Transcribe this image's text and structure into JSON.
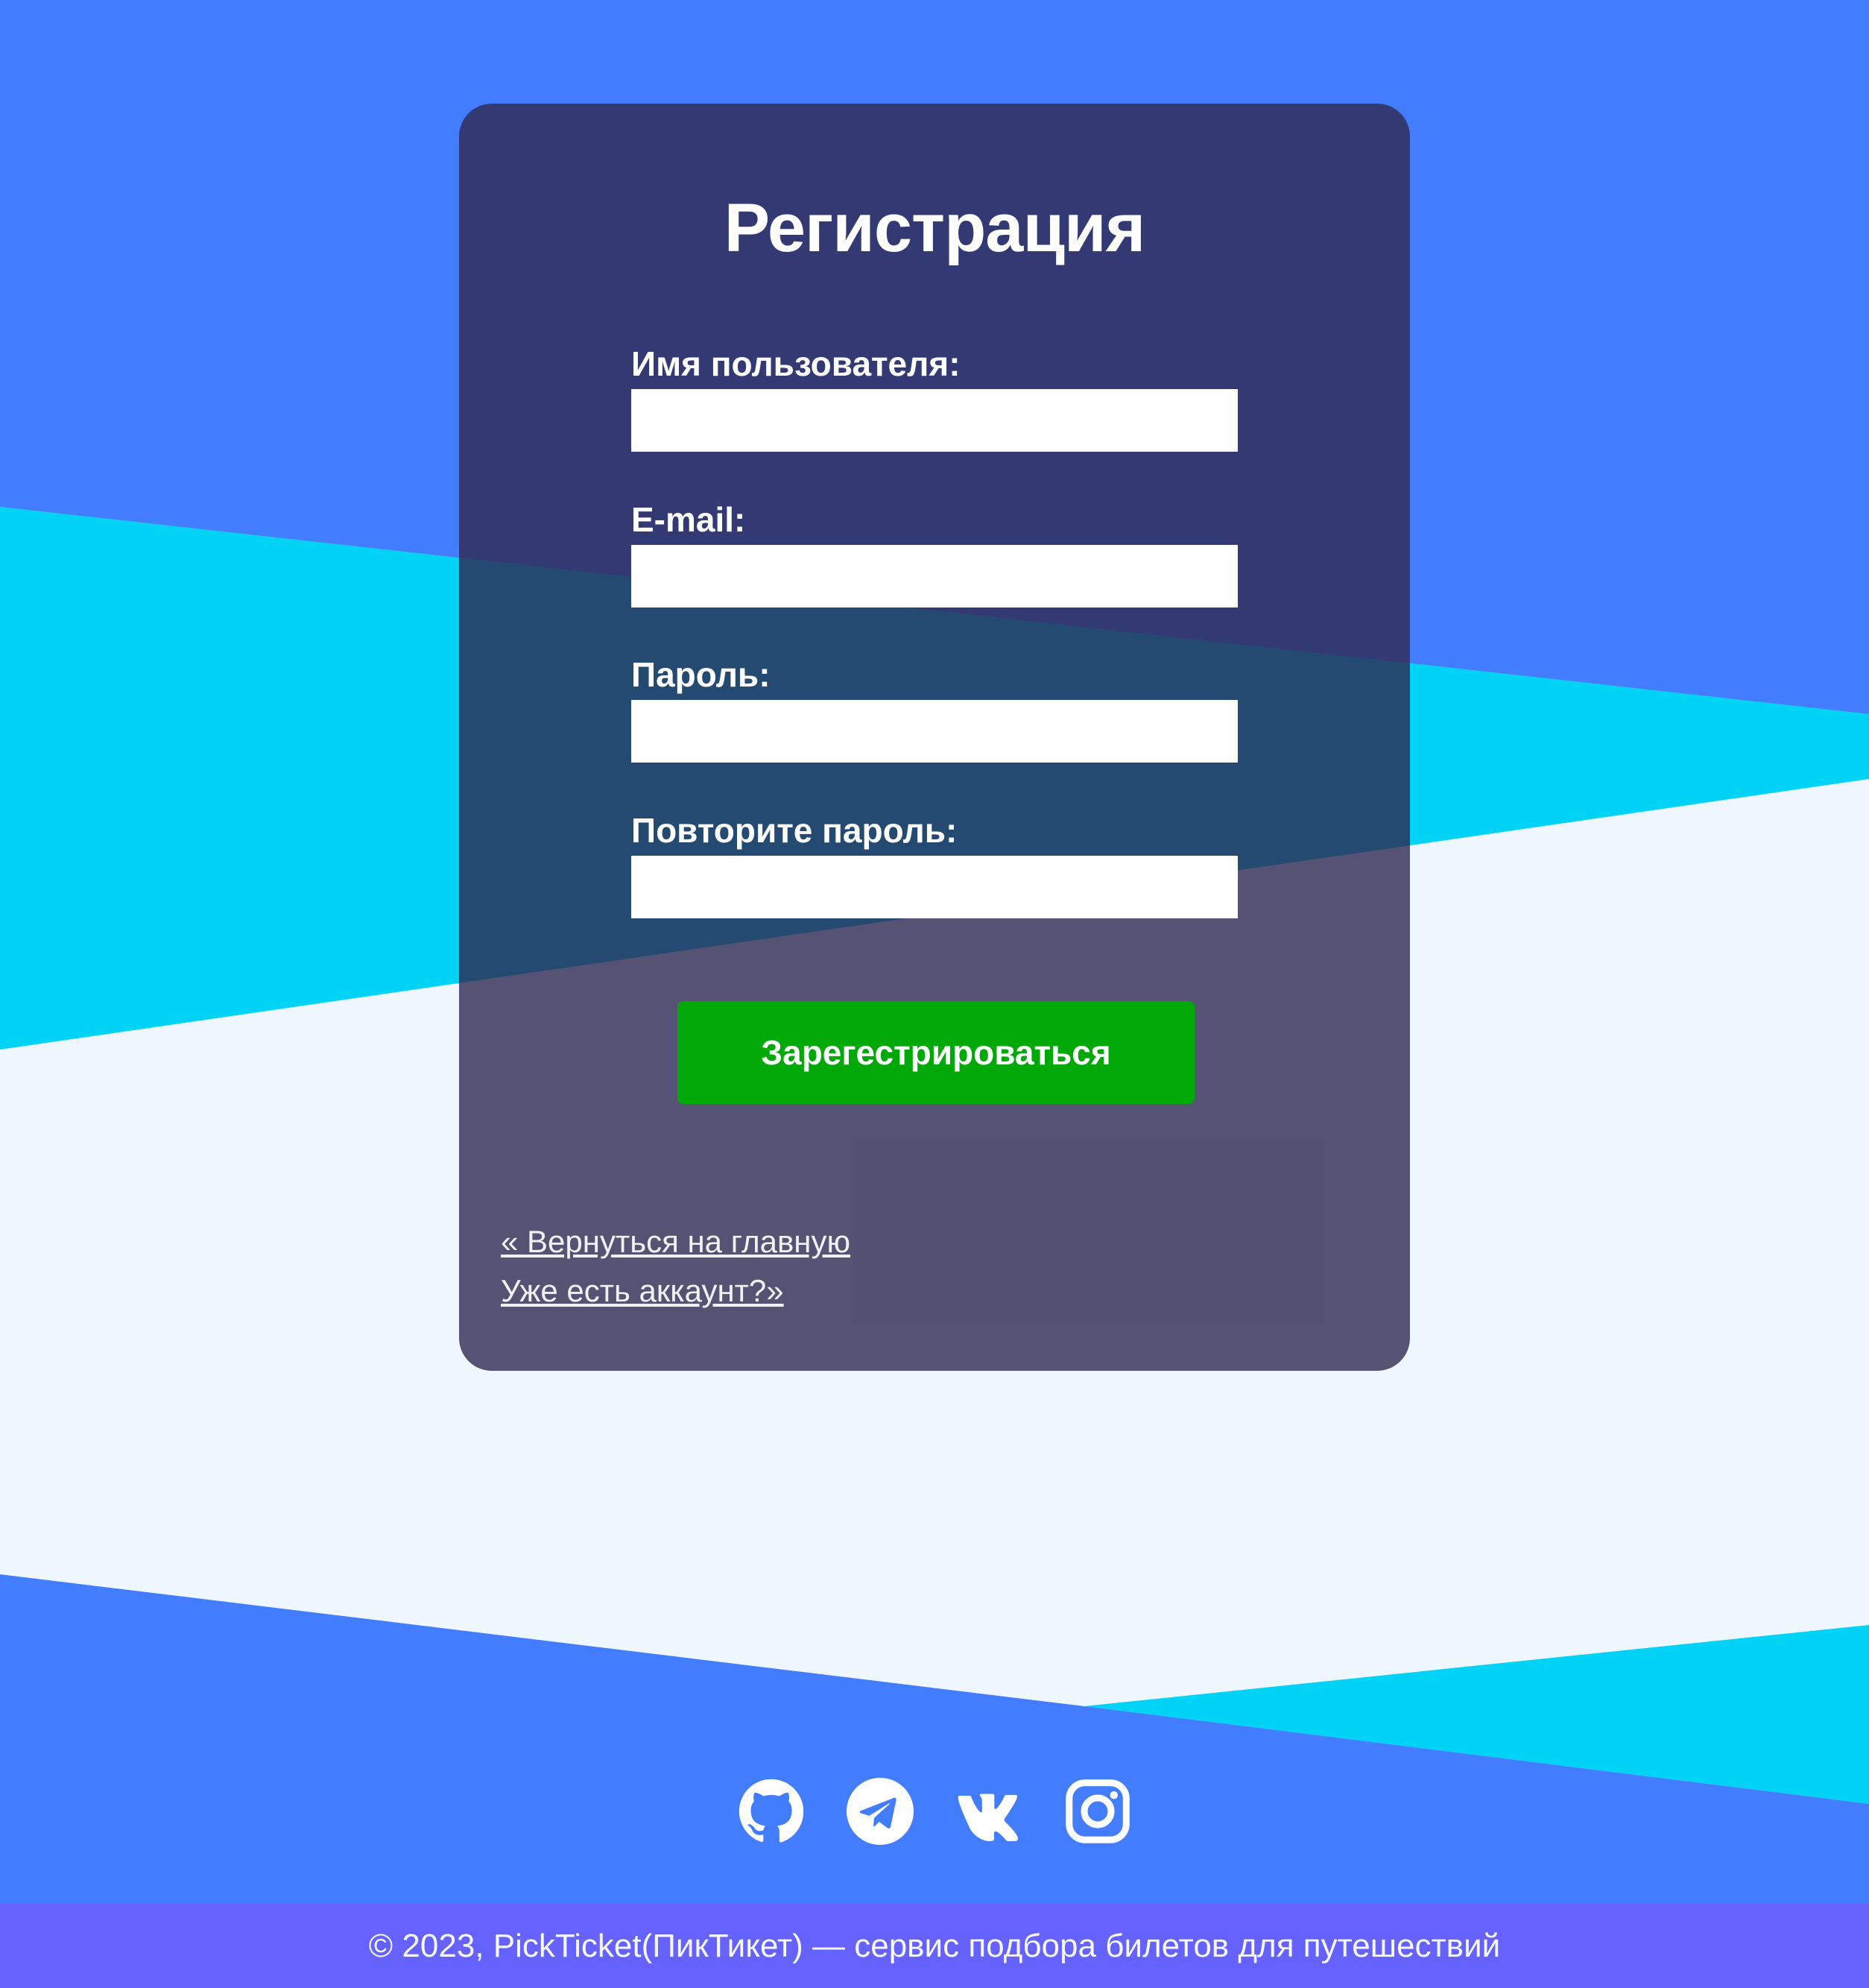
{
  "form": {
    "title": "Регистрация",
    "username_label": "Имя пользователя:",
    "username_value": "",
    "email_label": "E-mail:",
    "email_value": "",
    "password_label": "Пароль:",
    "password_value": "",
    "repeat_password_label": "Повторите пароль:",
    "repeat_password_value": "",
    "submit_label": "Зарегестрироваться",
    "back_link": "« Вернуться на главную",
    "login_link": "Уже есть аккаунт?»"
  },
  "social": [
    {
      "icon": "github-icon"
    },
    {
      "icon": "telegram-icon"
    },
    {
      "icon": "vk-icon"
    },
    {
      "icon": "instagram-icon"
    }
  ],
  "footer": {
    "text": "© 2023, PickTicket(ПикТикет) — сервис подбора билетов для путешествий"
  },
  "colors": {
    "background_blue": "#427cff",
    "background_cyan": "#00d3f5",
    "background_light": "#eef7fd",
    "card_overlay": "#2e2850",
    "submit_button": "#00a808",
    "footer": "#6562ff"
  }
}
